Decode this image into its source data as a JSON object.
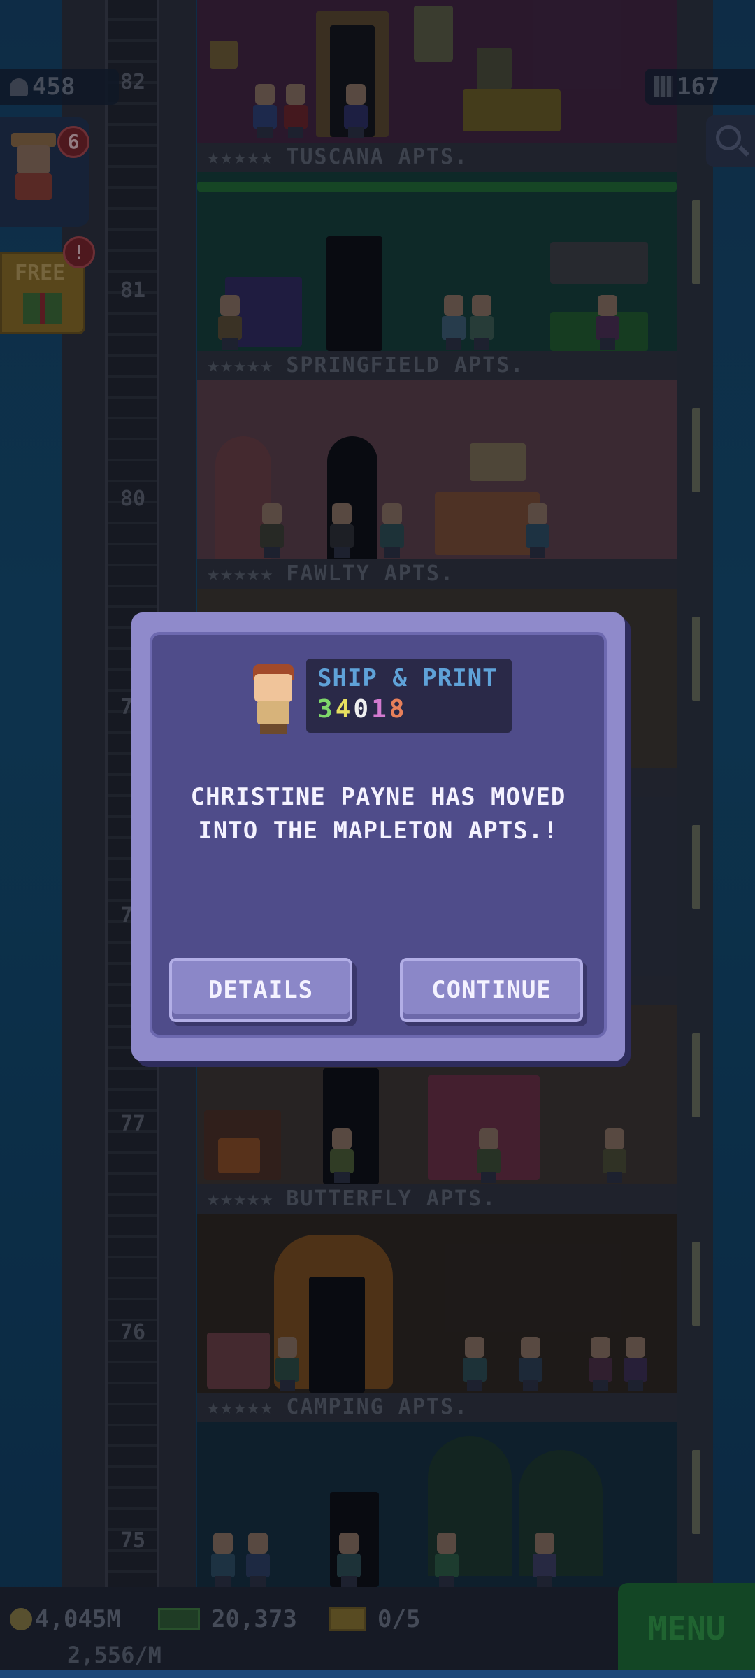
{
  "hud": {
    "population": "458",
    "tower_bux": "167"
  },
  "vip": {
    "count": "6"
  },
  "free_gift": {
    "label": "FREE",
    "alert": "!"
  },
  "floors": [
    {
      "number": "82",
      "name": "TUSCANA APTS.",
      "stars": "★★★★★"
    },
    {
      "number": "81",
      "name": "SPRINGFIELD APTS.",
      "stars": "★★★★★"
    },
    {
      "number": "80",
      "name": "FAWLTY APTS.",
      "stars": "★★★★★"
    },
    {
      "number": "79",
      "name": "",
      "stars": ""
    },
    {
      "number": "78",
      "name": "",
      "stars": ""
    },
    {
      "number": "77",
      "name": "BUTTERFLY APTS.",
      "stars": "★★★★★"
    },
    {
      "number": "76",
      "name": "CAMPING APTS.",
      "stars": "★★★★★"
    },
    {
      "number": "75",
      "name": "",
      "stars": ""
    }
  ],
  "colors": {
    "tuscana": "#3f2036",
    "springfield": "#123a30",
    "fawlty": "#5a3a40",
    "floor79": "#3a3326",
    "floor78": "#2c3038",
    "butterfly": "#3a3128",
    "camping": "#2c2216",
    "floor75": "#122a36"
  },
  "dialog": {
    "job_title": "SHIP & PRINT",
    "dream_digits": [
      {
        "d": "3",
        "color": "#7fd86a"
      },
      {
        "d": "4",
        "color": "#e8e060"
      },
      {
        "d": "0",
        "color": "#f0f0f0"
      },
      {
        "d": "1",
        "color": "#d47ad0"
      },
      {
        "d": "8",
        "color": "#e8805a"
      }
    ],
    "message": "CHRISTINE PAYNE HAS MOVED INTO THE MAPLETON APTS.!",
    "details_label": "DETAILS",
    "continue_label": "CONTINUE"
  },
  "bottom": {
    "coins": "4,045M",
    "bux_cash": "20,373",
    "tickets": "0/5",
    "rate": "2,556/M",
    "menu_label": "MENU"
  }
}
